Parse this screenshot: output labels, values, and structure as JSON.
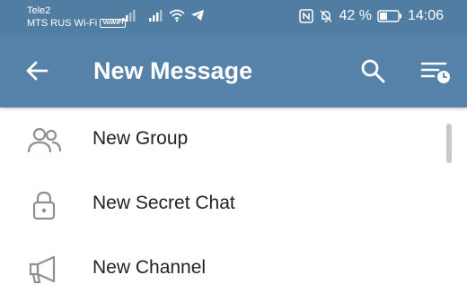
{
  "status_bar": {
    "carrier_1": "Tele2",
    "carrier_2": "MTS RUS Wi-Fi",
    "volte_badge": "VoWiFi",
    "battery_percent": "42 %",
    "time": "14:06",
    "icons": [
      "signal-icon",
      "signal-icon",
      "wifi-icon",
      "telegram-icon",
      "nfc-icon",
      "bell-off-icon",
      "battery-icon"
    ],
    "battery_level": 0.42
  },
  "toolbar": {
    "title": "New Message",
    "back_icon": "arrow-left-icon",
    "search_icon": "search-icon",
    "sort_icon": "sort-clock-icon",
    "color": "#5682a9"
  },
  "menu": {
    "items": [
      {
        "label": "New Group",
        "icon": "group-icon"
      },
      {
        "label": "New Secret Chat",
        "icon": "lock-icon"
      },
      {
        "label": "New Channel",
        "icon": "megaphone-icon"
      }
    ]
  }
}
